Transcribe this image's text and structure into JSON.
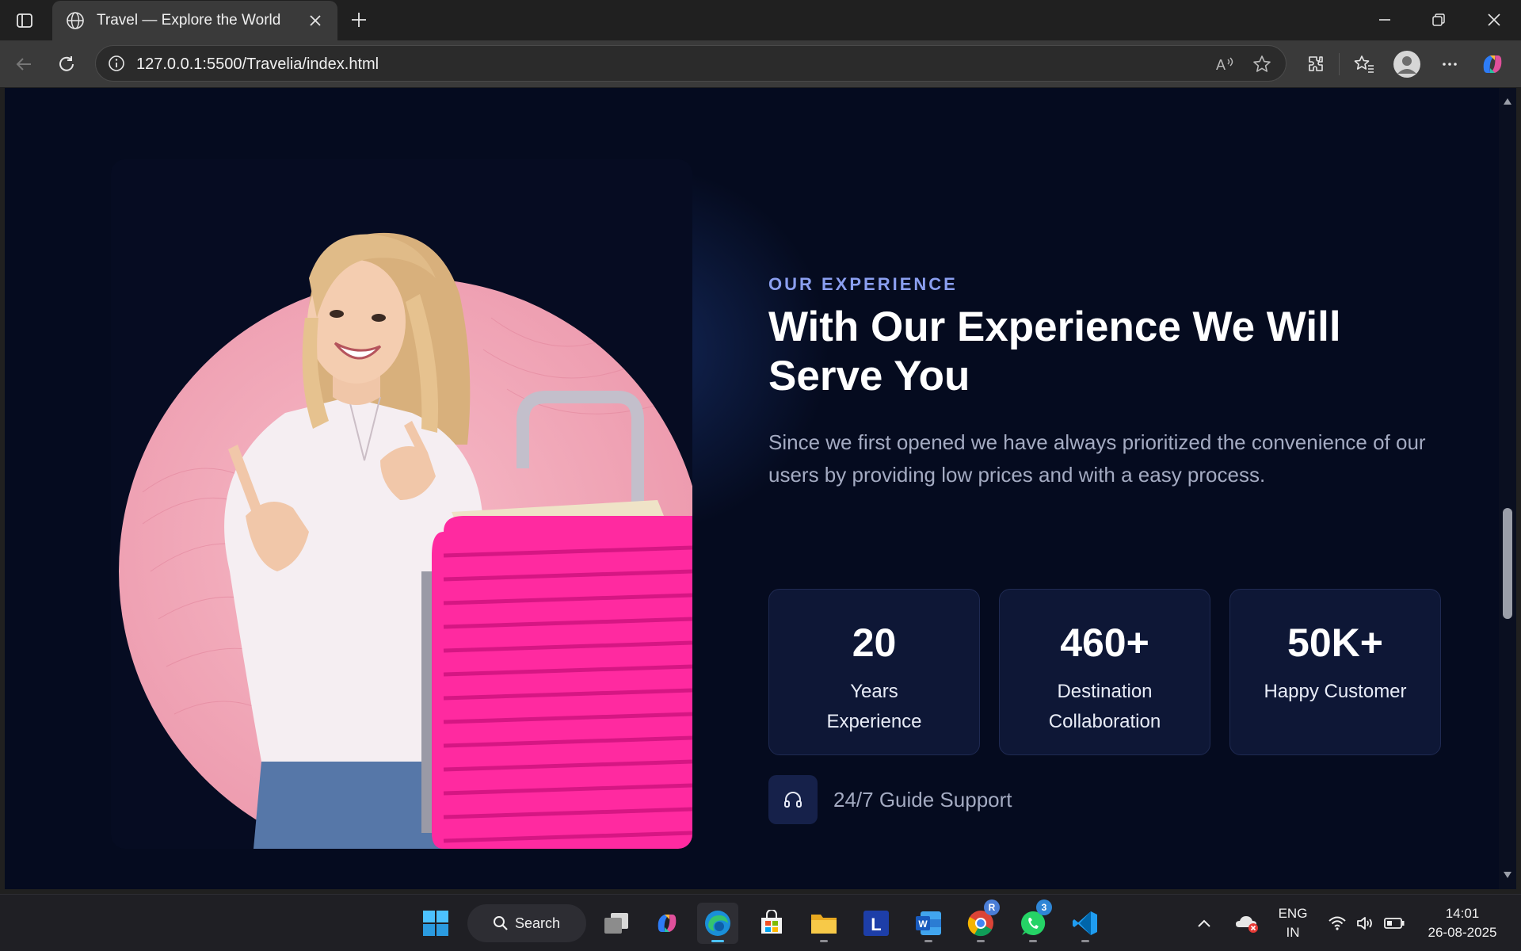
{
  "browser": {
    "tab_title": "Travel — Explore the World",
    "url": "127.0.0.1:5500/Travelia/index.html"
  },
  "section": {
    "eyebrow": "OUR EXPERIENCE",
    "heading": "With Our Experience We Will Serve You",
    "description": "Since we first opened we have always prioritized the convenience of our users by providing low prices and with a easy process.",
    "stats": [
      {
        "value": "20",
        "label": "Years Experience"
      },
      {
        "value": "460+",
        "label": "Destination Collaboration"
      },
      {
        "value": "50K+",
        "label": "Happy Customer"
      }
    ],
    "support_text": "24/7 Guide Support"
  },
  "taskbar": {
    "search_label": "Search",
    "lang_line1": "ENG",
    "lang_line2": "IN",
    "time": "14:01",
    "date": "26-08-2025",
    "chrome_badge": "R",
    "whatsapp_badge": "3"
  },
  "colors": {
    "page_bg": "#050b1f",
    "accent": "#8b9ff0",
    "card_bg": "#0e1736",
    "suitcase": "#ff2aa0",
    "circle": "#f4a9b9"
  }
}
